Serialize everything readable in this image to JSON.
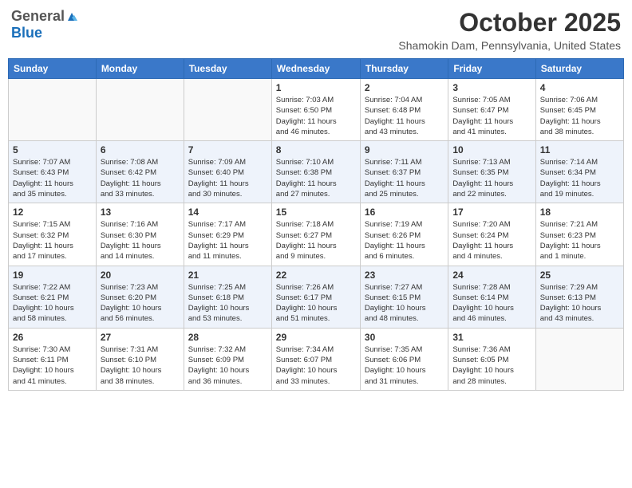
{
  "logo": {
    "general": "General",
    "blue": "Blue"
  },
  "title": "October 2025",
  "subtitle": "Shamokin Dam, Pennsylvania, United States",
  "headers": [
    "Sunday",
    "Monday",
    "Tuesday",
    "Wednesday",
    "Thursday",
    "Friday",
    "Saturday"
  ],
  "weeks": [
    [
      {
        "day": "",
        "info": ""
      },
      {
        "day": "",
        "info": ""
      },
      {
        "day": "",
        "info": ""
      },
      {
        "day": "1",
        "info": "Sunrise: 7:03 AM\nSunset: 6:50 PM\nDaylight: 11 hours\nand 46 minutes."
      },
      {
        "day": "2",
        "info": "Sunrise: 7:04 AM\nSunset: 6:48 PM\nDaylight: 11 hours\nand 43 minutes."
      },
      {
        "day": "3",
        "info": "Sunrise: 7:05 AM\nSunset: 6:47 PM\nDaylight: 11 hours\nand 41 minutes."
      },
      {
        "day": "4",
        "info": "Sunrise: 7:06 AM\nSunset: 6:45 PM\nDaylight: 11 hours\nand 38 minutes."
      }
    ],
    [
      {
        "day": "5",
        "info": "Sunrise: 7:07 AM\nSunset: 6:43 PM\nDaylight: 11 hours\nand 35 minutes."
      },
      {
        "day": "6",
        "info": "Sunrise: 7:08 AM\nSunset: 6:42 PM\nDaylight: 11 hours\nand 33 minutes."
      },
      {
        "day": "7",
        "info": "Sunrise: 7:09 AM\nSunset: 6:40 PM\nDaylight: 11 hours\nand 30 minutes."
      },
      {
        "day": "8",
        "info": "Sunrise: 7:10 AM\nSunset: 6:38 PM\nDaylight: 11 hours\nand 27 minutes."
      },
      {
        "day": "9",
        "info": "Sunrise: 7:11 AM\nSunset: 6:37 PM\nDaylight: 11 hours\nand 25 minutes."
      },
      {
        "day": "10",
        "info": "Sunrise: 7:13 AM\nSunset: 6:35 PM\nDaylight: 11 hours\nand 22 minutes."
      },
      {
        "day": "11",
        "info": "Sunrise: 7:14 AM\nSunset: 6:34 PM\nDaylight: 11 hours\nand 19 minutes."
      }
    ],
    [
      {
        "day": "12",
        "info": "Sunrise: 7:15 AM\nSunset: 6:32 PM\nDaylight: 11 hours\nand 17 minutes."
      },
      {
        "day": "13",
        "info": "Sunrise: 7:16 AM\nSunset: 6:30 PM\nDaylight: 11 hours\nand 14 minutes."
      },
      {
        "day": "14",
        "info": "Sunrise: 7:17 AM\nSunset: 6:29 PM\nDaylight: 11 hours\nand 11 minutes."
      },
      {
        "day": "15",
        "info": "Sunrise: 7:18 AM\nSunset: 6:27 PM\nDaylight: 11 hours\nand 9 minutes."
      },
      {
        "day": "16",
        "info": "Sunrise: 7:19 AM\nSunset: 6:26 PM\nDaylight: 11 hours\nand 6 minutes."
      },
      {
        "day": "17",
        "info": "Sunrise: 7:20 AM\nSunset: 6:24 PM\nDaylight: 11 hours\nand 4 minutes."
      },
      {
        "day": "18",
        "info": "Sunrise: 7:21 AM\nSunset: 6:23 PM\nDaylight: 11 hours\nand 1 minute."
      }
    ],
    [
      {
        "day": "19",
        "info": "Sunrise: 7:22 AM\nSunset: 6:21 PM\nDaylight: 10 hours\nand 58 minutes."
      },
      {
        "day": "20",
        "info": "Sunrise: 7:23 AM\nSunset: 6:20 PM\nDaylight: 10 hours\nand 56 minutes."
      },
      {
        "day": "21",
        "info": "Sunrise: 7:25 AM\nSunset: 6:18 PM\nDaylight: 10 hours\nand 53 minutes."
      },
      {
        "day": "22",
        "info": "Sunrise: 7:26 AM\nSunset: 6:17 PM\nDaylight: 10 hours\nand 51 minutes."
      },
      {
        "day": "23",
        "info": "Sunrise: 7:27 AM\nSunset: 6:15 PM\nDaylight: 10 hours\nand 48 minutes."
      },
      {
        "day": "24",
        "info": "Sunrise: 7:28 AM\nSunset: 6:14 PM\nDaylight: 10 hours\nand 46 minutes."
      },
      {
        "day": "25",
        "info": "Sunrise: 7:29 AM\nSunset: 6:13 PM\nDaylight: 10 hours\nand 43 minutes."
      }
    ],
    [
      {
        "day": "26",
        "info": "Sunrise: 7:30 AM\nSunset: 6:11 PM\nDaylight: 10 hours\nand 41 minutes."
      },
      {
        "day": "27",
        "info": "Sunrise: 7:31 AM\nSunset: 6:10 PM\nDaylight: 10 hours\nand 38 minutes."
      },
      {
        "day": "28",
        "info": "Sunrise: 7:32 AM\nSunset: 6:09 PM\nDaylight: 10 hours\nand 36 minutes."
      },
      {
        "day": "29",
        "info": "Sunrise: 7:34 AM\nSunset: 6:07 PM\nDaylight: 10 hours\nand 33 minutes."
      },
      {
        "day": "30",
        "info": "Sunrise: 7:35 AM\nSunset: 6:06 PM\nDaylight: 10 hours\nand 31 minutes."
      },
      {
        "day": "31",
        "info": "Sunrise: 7:36 AM\nSunset: 6:05 PM\nDaylight: 10 hours\nand 28 minutes."
      },
      {
        "day": "",
        "info": ""
      }
    ]
  ]
}
